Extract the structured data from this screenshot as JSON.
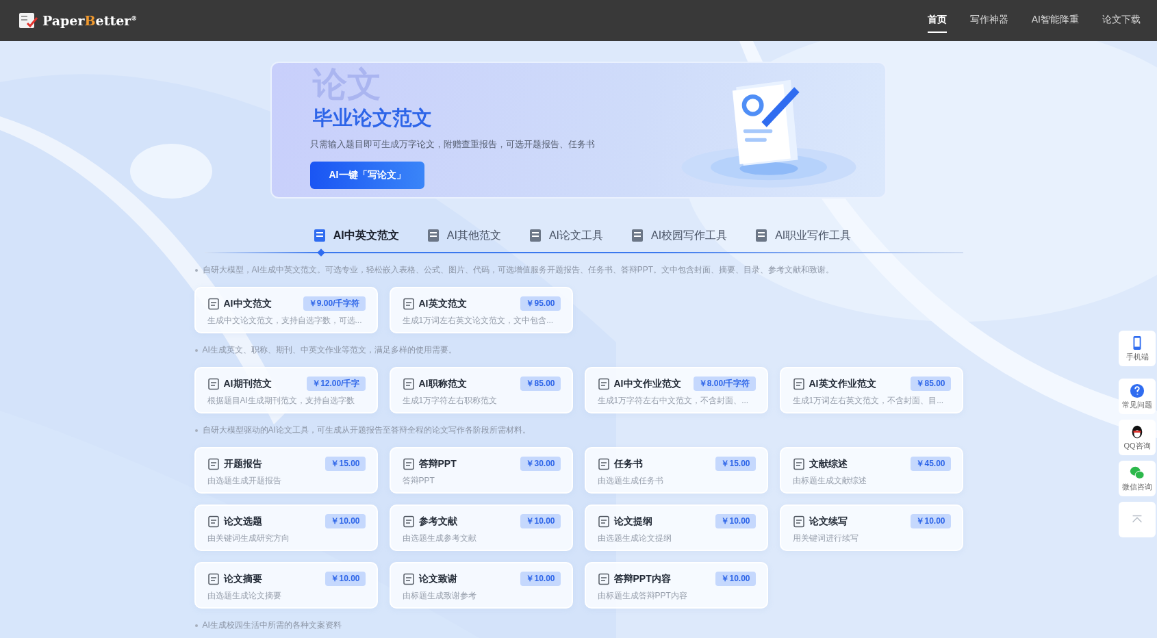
{
  "header": {
    "logo": {
      "before": "Paper",
      "accent": "B",
      "after": "etter",
      "mark": "®"
    },
    "nav": [
      {
        "label": "首页",
        "selected": true
      },
      {
        "label": "写作神器",
        "selected": false
      },
      {
        "label": "AI智能降重",
        "selected": false
      },
      {
        "label": "论文下载",
        "selected": false
      }
    ]
  },
  "banner": {
    "backdrop_text": "论文",
    "title": "毕业论文范文",
    "subtitle": "只需输入题目即可生成万字论文，附赠查重报告，可选开题报告、任务书",
    "button": "AI一键「写论文」"
  },
  "tabs": [
    {
      "label": "AI中英文范文",
      "selected": true
    },
    {
      "label": "AI其他范文",
      "selected": false
    },
    {
      "label": "AI论文工具",
      "selected": false
    },
    {
      "label": "AI校园写作工具",
      "selected": false
    },
    {
      "label": "AI职业写作工具",
      "selected": false
    }
  ],
  "sections": [
    {
      "description": "自研大模型，AI生成中英文范文。可选专业，轻松嵌入表格、公式、图片、代码，可选增值服务开题报告、任务书、答辩PPT。文中包含封面、摘要、目录、参考文献和致谢。",
      "cards": [
        {
          "title": "AI中文范文",
          "price": "￥9.00/千字符",
          "description": "生成中文论文范文，支持自选字数，可选..."
        },
        {
          "title": "AI英文范文",
          "price": "￥95.00",
          "description": "生成1万词左右英文论文范文，文中包含..."
        }
      ]
    },
    {
      "description": "AI生成英文、职称、期刊、中英文作业等范文，满足多样的使用需要。",
      "cards": [
        {
          "title": "AI期刊范文",
          "price": "￥12.00/千字",
          "description": "根据题目AI生成期刊范文，支持自选字数"
        },
        {
          "title": "AI职称范文",
          "price": "￥85.00",
          "description": "生成1万字符左右职称范文"
        },
        {
          "title": "AI中文作业范文",
          "price": "￥8.00/千字符",
          "description": "生成1万字符左右中文范文，不含封面、..."
        },
        {
          "title": "AI英文作业范文",
          "price": "￥85.00",
          "description": "生成1万词左右英文范文，不含封面、目..."
        }
      ]
    },
    {
      "description": "自研大模型驱动的AI论文工具，可生成从开题报告至答辩全程的论文写作各阶段所需材料。",
      "cards": [
        {
          "title": "开题报告",
          "price": "￥15.00",
          "description": "由选题生成开题报告"
        },
        {
          "title": "答辩PPT",
          "price": "￥30.00",
          "description": "答辩PPT"
        },
        {
          "title": "任务书",
          "price": "￥15.00",
          "description": "由选题生成任务书"
        },
        {
          "title": "文献综述",
          "price": "￥45.00",
          "description": "由标题生成文献综述"
        },
        {
          "title": "论文选题",
          "price": "￥10.00",
          "description": "由关键词生成研究方向"
        },
        {
          "title": "参考文献",
          "price": "￥10.00",
          "description": "由选题生成参考文献"
        },
        {
          "title": "论文提纲",
          "price": "￥10.00",
          "description": "由选题生成论文提纲"
        },
        {
          "title": "论文续写",
          "price": "￥10.00",
          "description": "用关键词进行续写"
        },
        {
          "title": "论文摘要",
          "price": "￥10.00",
          "description": "由选题生成论文摘要"
        },
        {
          "title": "论文致谢",
          "price": "￥10.00",
          "description": "由标题生成致谢参考"
        },
        {
          "title": "答辩PPT内容",
          "price": "￥10.00",
          "description": "由标题生成答辩PPT内容"
        }
      ]
    },
    {
      "description": "AI生成校园生活中所需的各种文案资料"
    }
  ],
  "side_tools": [
    {
      "kind": "phone",
      "label": "手机端"
    },
    {
      "kind": "help",
      "label": "常见问题"
    },
    {
      "kind": "qq",
      "label": "QQ咨询"
    },
    {
      "kind": "wechat",
      "label": "微信咨询"
    },
    {
      "kind": "top"
    }
  ]
}
